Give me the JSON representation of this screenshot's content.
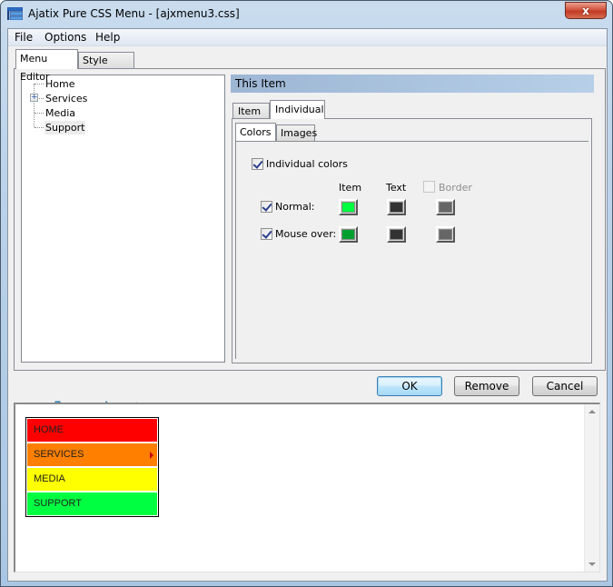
{
  "window": {
    "title": "Ajatix Pure CSS Menu - [ajxmenu3.css]",
    "icon": "app-menu-icon",
    "close_label": "x"
  },
  "menubar": {
    "items": [
      {
        "label": "File"
      },
      {
        "label": "Options"
      },
      {
        "label": "Help"
      }
    ]
  },
  "main_tabs": [
    {
      "label": "Menu Editor",
      "active": true
    },
    {
      "label": "Style Editor",
      "active": false
    }
  ],
  "tree": {
    "items": [
      {
        "label": "Home",
        "expandable": false,
        "selected": false
      },
      {
        "label": "Services",
        "expandable": true,
        "selected": false
      },
      {
        "label": "Media",
        "expandable": false,
        "selected": false
      },
      {
        "label": "Support",
        "expandable": false,
        "selected": true
      }
    ]
  },
  "item_panel": {
    "header": "This Item",
    "tabs": [
      {
        "label": "Item",
        "active": false
      },
      {
        "label": "Individual",
        "active": true
      }
    ],
    "sub_tabs": [
      {
        "label": "Colors",
        "active": true
      },
      {
        "label": "Images",
        "active": false
      }
    ],
    "individual_colors": {
      "label": "Individual colors",
      "checked": true
    },
    "columns": {
      "item": "Item",
      "text": "Text",
      "border": "Border",
      "border_checked": false,
      "border_enabled": false
    },
    "rows": [
      {
        "label": "Normal:",
        "checked": true,
        "item_color": "#00ff40",
        "text_color": "#333333",
        "border_color": "#666666"
      },
      {
        "label": "Mouse over:",
        "checked": true,
        "item_color": "#00a030",
        "text_color": "#333333",
        "border_color": "#666666"
      }
    ]
  },
  "toolbar": {
    "icons": [
      {
        "name": "add-item-icon"
      },
      {
        "name": "remove-item-icon"
      },
      {
        "name": "indent-right-icon"
      },
      {
        "name": "indent-left-icon"
      },
      {
        "name": "move-down-icon"
      },
      {
        "name": "move-up-icon"
      }
    ]
  },
  "buttons": {
    "ok": "OK",
    "remove": "Remove",
    "cancel": "Cancel"
  },
  "preview": {
    "menu_items": [
      {
        "label": "HOME",
        "color": "#ff0000",
        "has_submenu": false
      },
      {
        "label": "SERVICES",
        "color": "#ff7f00",
        "has_submenu": true
      },
      {
        "label": "MEDIA",
        "color": "#ffff00",
        "has_submenu": false
      },
      {
        "label": "SUPPORT",
        "color": "#00ff40",
        "has_submenu": false
      }
    ]
  }
}
